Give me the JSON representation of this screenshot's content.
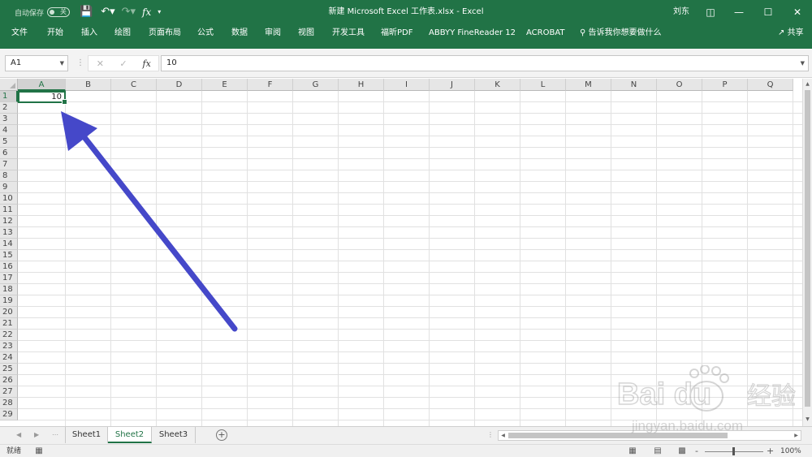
{
  "titlebar": {
    "autosave_label": "自动保存",
    "autosave_state": "关",
    "title": "新建 Microsoft Excel 工作表.xlsx  -  Excel",
    "user": "刘东",
    "qat_icons": [
      "save-icon",
      "undo-icon",
      "redo-icon",
      "fx-icon",
      "customize-icon"
    ]
  },
  "ribbon": {
    "tabs": [
      "文件",
      "开始",
      "插入",
      "绘图",
      "页面布局",
      "公式",
      "数据",
      "审阅",
      "视图",
      "开发工具",
      "福昕PDF",
      "ABBYY FineReader 12",
      "ACROBAT"
    ],
    "tell_me": "告诉我你想要做什么",
    "share": "共享"
  },
  "formula_bar": {
    "name_box": "A1",
    "value": "10"
  },
  "grid": {
    "columns": [
      "A",
      "B",
      "C",
      "D",
      "E",
      "F",
      "G",
      "H",
      "I",
      "J",
      "K",
      "L",
      "M",
      "N",
      "O",
      "P",
      "Q"
    ],
    "rows": [
      "1",
      "2",
      "3",
      "4",
      "5",
      "6",
      "7",
      "8",
      "9",
      "10",
      "11",
      "12",
      "13",
      "14",
      "15",
      "16",
      "17",
      "18",
      "19",
      "20",
      "21",
      "22",
      "23",
      "24",
      "25",
      "26",
      "27",
      "28",
      "29"
    ],
    "selected_cell": "A1",
    "cell_a1_value": "10"
  },
  "sheets": {
    "tabs": [
      "Sheet1",
      "Sheet2",
      "Sheet3"
    ],
    "active": "Sheet2"
  },
  "statusbar": {
    "status": "就绪",
    "zoom_minus": "-",
    "zoom_plus": "+",
    "zoom_level": "100%"
  },
  "colors": {
    "accent": "#217346",
    "annotation_arrow": "#4548c9"
  },
  "watermark": {
    "brand": "Baidu",
    "brand_cn": "经验",
    "url": "jingyan.baidu.com"
  }
}
